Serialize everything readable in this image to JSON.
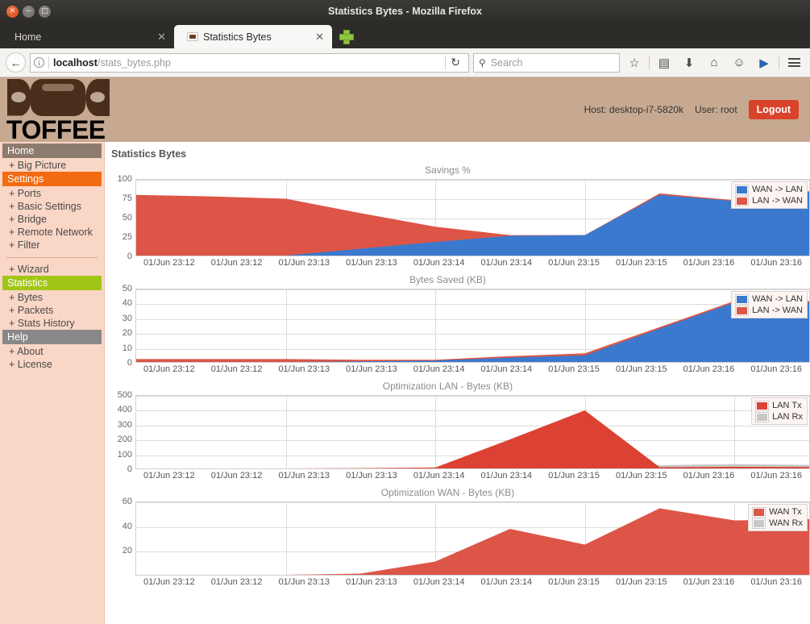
{
  "browser": {
    "window_title": "Statistics Bytes - Mozilla Firefox",
    "tabs": [
      {
        "label": "Home",
        "close": "✕",
        "active": false
      },
      {
        "label": "Statistics Bytes",
        "close": "✕",
        "active": true
      }
    ],
    "new_tab_tooltip": "+",
    "back_icon": "←",
    "url_info_icon": "i",
    "url_host": "localhost",
    "url_path": "/stats_bytes.php",
    "reload_icon": "↻",
    "search_placeholder": "Search",
    "search_icon": "⚲",
    "toolbar_icons": [
      "☆",
      "▤",
      "⬇",
      "⌂",
      "☺",
      "▶"
    ]
  },
  "header": {
    "logo_text": "TOFFEE",
    "host": "Host: desktop-i7-5820k",
    "user": "User: root",
    "logout": "Logout",
    "accent_red": "#d9422b",
    "bg": "#c7a991"
  },
  "sidebar": {
    "groups": [
      {
        "header": "Home",
        "type": "home",
        "items": [
          "+ Big Picture"
        ]
      },
      {
        "header": "Settings",
        "type": "settings",
        "items": [
          "+ Ports",
          "+ Basic Settings",
          "+ Bridge",
          "+ Remote Network",
          "+ Filter"
        ]
      },
      {
        "header": null,
        "type": "rule",
        "items": [
          "+ Wizard"
        ]
      },
      {
        "header": "Statistics",
        "type": "statistics",
        "items": [
          "+ Bytes",
          "+ Packets",
          "+ Stats History"
        ]
      },
      {
        "header": "Help",
        "type": "help",
        "items": [
          "+ About",
          "+ License"
        ]
      }
    ],
    "colors": {
      "home": "#8d7b6e",
      "settings": "#f36b10",
      "statistics": "#a2c617",
      "help": "#888888",
      "bg": "#fad6c6"
    }
  },
  "main": {
    "page_title": "Statistics Bytes"
  },
  "chart_data": [
    {
      "type": "area",
      "title": "Savings %",
      "xlabel": "",
      "ylabel": "",
      "ylim": [
        0,
        100
      ],
      "yticks": [
        0,
        25,
        50,
        75,
        100
      ],
      "grid": true,
      "legend_position": "top-right",
      "categories": [
        "01/Jun 23:12",
        "01/Jun 23:12",
        "01/Jun 23:13",
        "01/Jun 23:13",
        "01/Jun 23:14",
        "01/Jun 23:14",
        "01/Jun 23:15",
        "01/Jun 23:15",
        "01/Jun 23:16",
        "01/Jun 23:16"
      ],
      "series": [
        {
          "name": "LAN -> WAN",
          "color": "#dc5547",
          "values": [
            80,
            78,
            75,
            56,
            38,
            27,
            27,
            82,
            73,
            85
          ]
        },
        {
          "name": "WAN -> LAN",
          "color": "#3b79ce",
          "values": [
            0,
            0,
            0,
            9,
            18,
            26,
            27,
            80,
            72,
            84
          ]
        }
      ]
    },
    {
      "type": "area",
      "title": "Bytes Saved (KB)",
      "xlabel": "",
      "ylabel": "",
      "ylim": [
        0,
        50
      ],
      "yticks": [
        0,
        10,
        20,
        30,
        40,
        50
      ],
      "grid": true,
      "legend_position": "top-right",
      "categories": [
        "01/Jun 23:12",
        "01/Jun 23:12",
        "01/Jun 23:13",
        "01/Jun 23:13",
        "01/Jun 23:14",
        "01/Jun 23:14",
        "01/Jun 23:15",
        "01/Jun 23:15",
        "01/Jun 23:16",
        "01/Jun 23:16"
      ],
      "series": [
        {
          "name": "LAN -> WAN",
          "color": "#dc5547",
          "values": [
            2,
            2,
            2,
            1.5,
            1.5,
            4,
            6,
            24,
            42,
            42
          ]
        },
        {
          "name": "WAN -> LAN",
          "color": "#3b79ce",
          "values": [
            0,
            0,
            0,
            0.4,
            1,
            3,
            4.5,
            23,
            41,
            41
          ]
        }
      ]
    },
    {
      "type": "area",
      "title": "Optimization LAN - Bytes (KB)",
      "xlabel": "",
      "ylabel": "",
      "ylim": [
        0,
        500
      ],
      "yticks": [
        0,
        100,
        200,
        300,
        400,
        500
      ],
      "grid": true,
      "legend_position": "top-right",
      "categories": [
        "01/Jun 23:12",
        "01/Jun 23:12",
        "01/Jun 23:13",
        "01/Jun 23:13",
        "01/Jun 23:14",
        "01/Jun 23:14",
        "01/Jun 23:15",
        "01/Jun 23:15",
        "01/Jun 23:16",
        "01/Jun 23:16"
      ],
      "series": [
        {
          "name": "LAN Rx",
          "color": "#c8c8c8",
          "values": [
            0,
            0,
            0,
            0,
            1,
            2,
            3,
            22,
            30,
            24
          ]
        },
        {
          "name": "LAN Tx",
          "color": "#dc4233",
          "values": [
            0,
            0,
            0,
            2,
            6,
            200,
            400,
            8,
            11,
            10
          ]
        }
      ]
    },
    {
      "type": "area",
      "title": "Optimization WAN - Bytes (KB)",
      "xlabel": "",
      "ylabel": "",
      "ylim": [
        0,
        60
      ],
      "yticks": [
        20,
        40,
        60
      ],
      "grid": true,
      "legend_position": "top-right",
      "categories": [
        "01/Jun 23:12",
        "01/Jun 23:12",
        "01/Jun 23:13",
        "01/Jun 23:13",
        "01/Jun 23:14",
        "01/Jun 23:14",
        "01/Jun 23:15",
        "01/Jun 23:15",
        "01/Jun 23:16",
        "01/Jun 23:16"
      ],
      "series": [
        {
          "name": "WAN Rx",
          "color": "#c8c8c8",
          "values": [
            0,
            0,
            0,
            0,
            1,
            3,
            5,
            9,
            12,
            11
          ]
        },
        {
          "name": "WAN Tx",
          "color": "#dc5547",
          "values": [
            0,
            0,
            0,
            1,
            11,
            38,
            25,
            55,
            45,
            46
          ]
        }
      ]
    }
  ]
}
